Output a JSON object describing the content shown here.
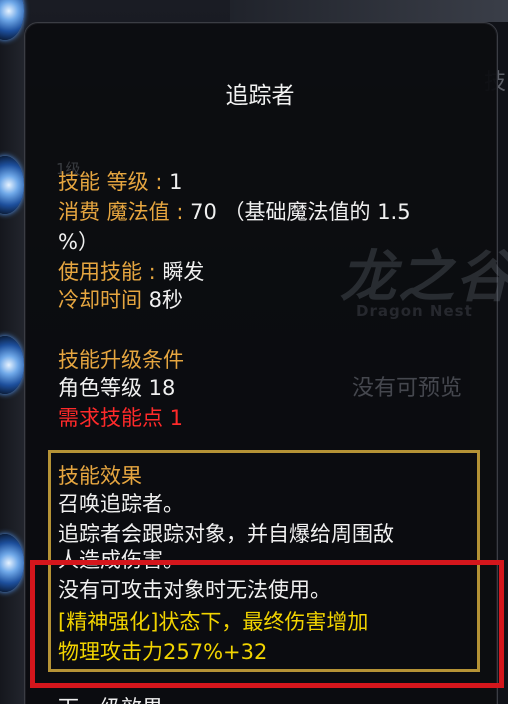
{
  "tooltip": {
    "title": "追踪者",
    "stats": {
      "skill_level_label": "技能 等级",
      "skill_level_sep": " : ",
      "skill_level_value": "1",
      "cost_label": "消费 魔法值",
      "cost_sep": " : ",
      "cost_value_line1": "70 （基础魔法值的 1.5",
      "cost_value_line2": "%）",
      "use_label": "使用技能",
      "use_sep": " : ",
      "use_value": "瞬发",
      "cooldown_label": "冷却时间",
      "cooldown_value": " 8秒"
    },
    "upgrade": {
      "header": "技能升级条件",
      "char_level": "角色等级 18",
      "required_points": "需求技能点 1"
    },
    "effect": {
      "header": "技能效果",
      "line1": "召唤追踪者。",
      "line2": "追踪者会跟踪对象，并自爆给周围敌",
      "line3": "人造成伤害。",
      "line4": "没有可攻击对象时无法使用。",
      "line5": "[精神强化]状态下，最终伤害增加",
      "line6": "物理攻击力257%+32"
    },
    "next_level_cut": "下一级效果"
  },
  "background": {
    "ghost_level": "1级",
    "watermark": "龙之谷",
    "watermark_sub": "Dragon Nest",
    "no_preview": "没有可预览",
    "right_char": "技"
  },
  "colors": {
    "label": "#e6a640",
    "text": "#f0f0f0",
    "red": "#ff2a2a",
    "yellow": "#f2d400",
    "effect_border": "#b59336",
    "highlight_border": "#d4161c"
  }
}
